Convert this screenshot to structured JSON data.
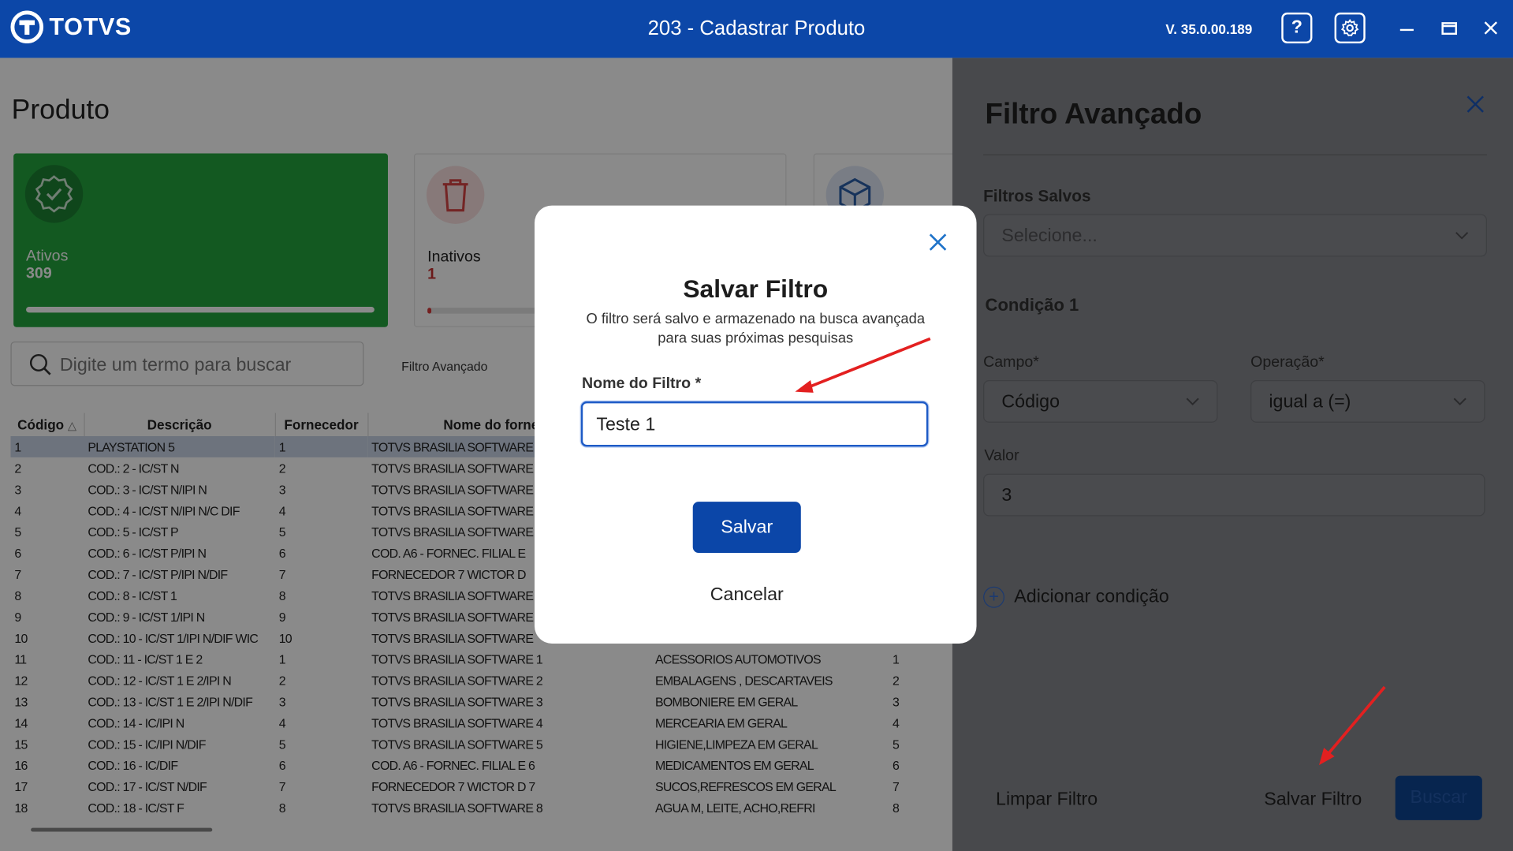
{
  "window": {
    "brand": "TOTVS",
    "title": "203 - Cadastrar  Produto",
    "version": "V. 35.0.00.189",
    "help_label": "?"
  },
  "page": {
    "title": "Produto",
    "cards": [
      {
        "label": "Ativos",
        "value": "309",
        "progress": 1.0,
        "color": "#23a43d"
      },
      {
        "label": "Inativos",
        "value": "1",
        "progress": 0.01,
        "color": "#c94040"
      }
    ],
    "search_placeholder": "Digite um termo para buscar",
    "advanced_filter_link": "Filtro Avançado"
  },
  "table": {
    "headers": [
      "Código",
      "Descrição",
      "Fornecedor",
      "Nome do fornecedor",
      "",
      ""
    ],
    "sort_indicator": "△",
    "rows": [
      [
        "1",
        "PLAYSTATION 5",
        "1",
        "TOTVS BRASILIA SOFTWARE",
        "",
        ""
      ],
      [
        "2",
        "COD.: 2 - IC/ST N",
        "2",
        "TOTVS BRASILIA SOFTWARE",
        "",
        ""
      ],
      [
        "3",
        "COD.: 3 - IC/ST N/IPI N",
        "3",
        "TOTVS BRASILIA SOFTWARE",
        "",
        ""
      ],
      [
        "4",
        "COD.: 4 - IC/ST N/IPI N/C DIF",
        "4",
        "TOTVS BRASILIA SOFTWARE",
        "",
        ""
      ],
      [
        "5",
        "COD.: 5 - IC/ST P",
        "5",
        "TOTVS BRASILIA SOFTWARE",
        "",
        ""
      ],
      [
        "6",
        "COD.: 6 - IC/ST P/IPI N",
        "6",
        "COD. A6 - FORNEC. FILIAL E",
        "",
        ""
      ],
      [
        "7",
        "COD.: 7 - IC/ST P/IPI N/DIF",
        "7",
        "FORNECEDOR 7 WICTOR D",
        "",
        ""
      ],
      [
        "8",
        "COD.: 8 - IC/ST 1",
        "8",
        "TOTVS BRASILIA SOFTWARE",
        "",
        ""
      ],
      [
        "9",
        "COD.: 9 - IC/ST 1/IPI N",
        "9",
        "TOTVS BRASILIA SOFTWARE",
        "",
        ""
      ],
      [
        "10",
        "COD.: 10 - IC/ST 1/IPI N/DIF WIC",
        "10",
        "TOTVS BRASILIA SOFTWARE",
        "",
        ""
      ],
      [
        "11",
        "COD.: 11 - IC/ST 1 E 2",
        "1",
        "TOTVS BRASILIA SOFTWARE 1",
        "ACESSORIOS AUTOMOTIVOS",
        "1"
      ],
      [
        "12",
        "COD.: 12 - IC/ST 1 E 2/IPI N",
        "2",
        "TOTVS BRASILIA SOFTWARE 2",
        "EMBALAGENS , DESCARTAVEIS",
        "2"
      ],
      [
        "13",
        "COD.: 13 - IC/ST 1 E 2/IPI N/DIF",
        "3",
        "TOTVS BRASILIA SOFTWARE 3",
        "BOMBONIERE EM GERAL",
        "3"
      ],
      [
        "14",
        "COD.: 14 - IC/IPI N",
        "4",
        "TOTVS BRASILIA SOFTWARE 4",
        "MERCEARIA EM GERAL",
        "4"
      ],
      [
        "15",
        "COD.: 15 - IC/IPI N/DIF",
        "5",
        "TOTVS BRASILIA SOFTWARE 5",
        "HIGIENE,LIMPEZA EM GERAL",
        "5"
      ],
      [
        "16",
        "COD.: 16 - IC/DIF",
        "6",
        "COD. A6 - FORNEC. FILIAL E 6",
        "MEDICAMENTOS EM GERAL",
        "6"
      ],
      [
        "17",
        "COD.: 17 - IC/ST N/DIF",
        "7",
        "FORNECEDOR 7 WICTOR D 7",
        "SUCOS,REFRESCOS EM GERAL",
        "7"
      ],
      [
        "18",
        "COD.: 18 - IC/ST F",
        "8",
        "TOTVS BRASILIA SOFTWARE 8",
        "AGUA M, LEITE, ACHO,REFRI",
        "8"
      ]
    ]
  },
  "panel": {
    "title": "Filtro Avançado",
    "saved_filters_label": "Filtros Salvos",
    "saved_filters_placeholder": "Selecione...",
    "condition_title": "Condição 1",
    "field_label": "Campo*",
    "field_value": "Código",
    "operation_label": "Operação*",
    "operation_value": "igual a (=)",
    "value_label": "Valor",
    "value_value": "3",
    "add_condition": "Adicionar condição",
    "clear_filter": "Limpar Filtro",
    "save_filter": "Salvar Filtro",
    "search": "Buscar"
  },
  "modal": {
    "title": "Salvar Filtro",
    "description_line1": "O filtro será salvo e armazenado na busca avançada",
    "description_line2": "para suas próximas pesquisas",
    "name_label": "Nome do Filtro *",
    "name_value": "Teste 1",
    "save_button": "Salvar",
    "cancel_button": "Cancelar"
  },
  "annotation_color": "#e32020"
}
